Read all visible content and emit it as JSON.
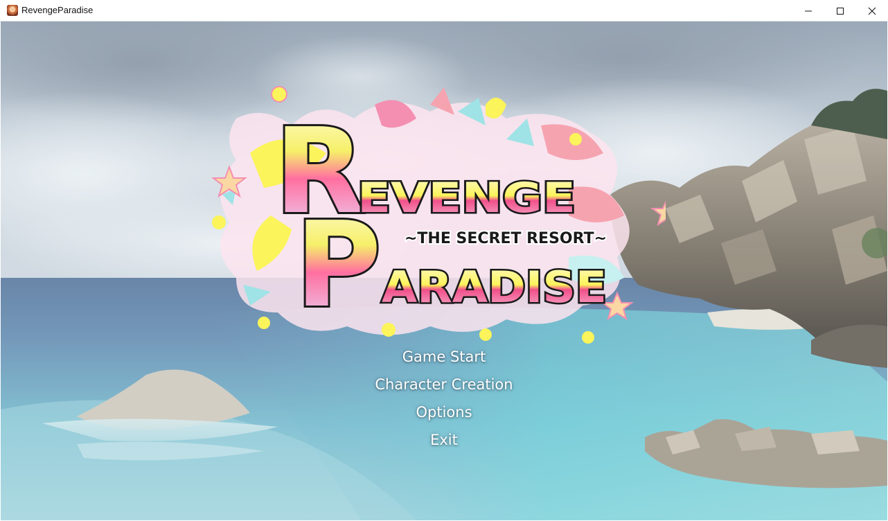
{
  "window": {
    "title": "RevengeParadise",
    "icon": "app-icon",
    "controls": [
      "minimize-icon",
      "maximize-icon",
      "close-icon"
    ]
  },
  "logo": {
    "initial_r": "R",
    "initial_p": "P",
    "word_revenge": "EVENGE",
    "word_paradise": "ARADISE",
    "subtitle": "~THE SECRET RESORT~"
  },
  "menu": {
    "items": [
      {
        "label": "Game Start"
      },
      {
        "label": "Character Creation"
      },
      {
        "label": "Options"
      },
      {
        "label": "Exit"
      }
    ]
  },
  "colors": {
    "menu_text": "#ffffff",
    "logo_pink": "#f0508a",
    "logo_yellow": "#fbf45a",
    "logo_outline": "#1a1a1a"
  }
}
